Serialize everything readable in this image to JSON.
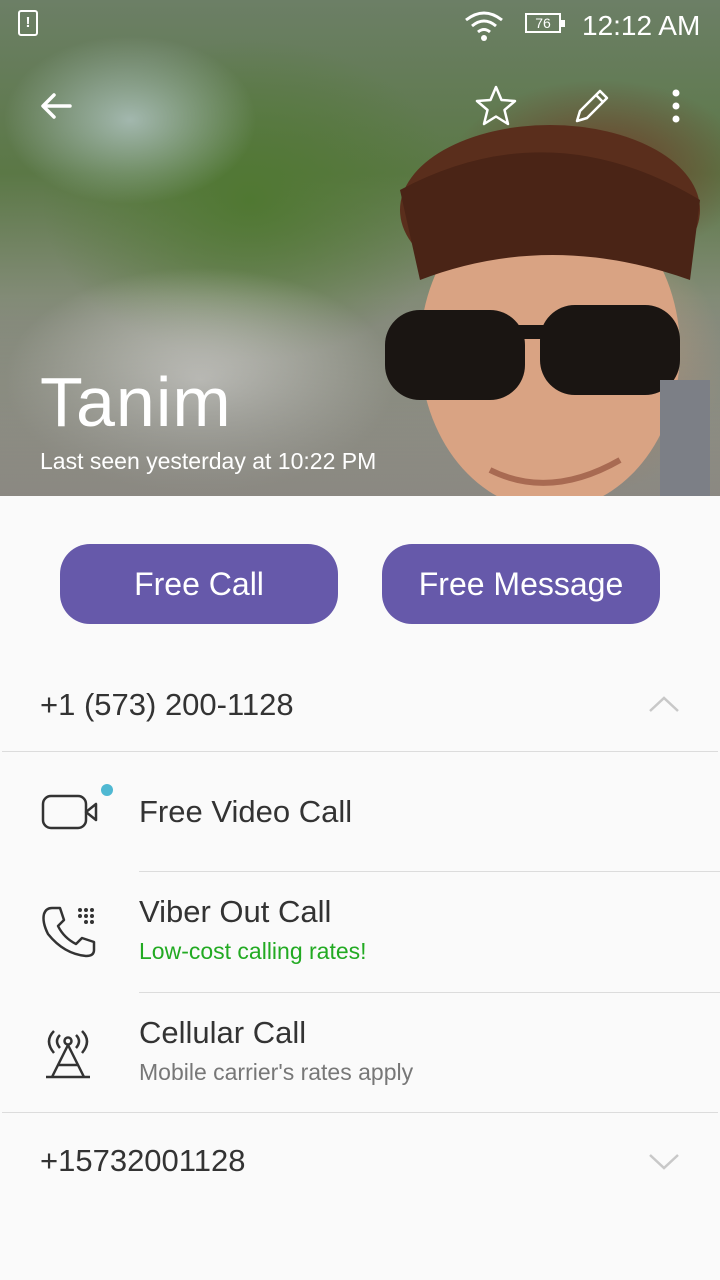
{
  "status_bar": {
    "notice_icon": "sim-alert-icon",
    "notice_glyph": "!",
    "battery_level": "76",
    "time": "12:12 AM"
  },
  "toolbar": {
    "back_icon": "back-arrow-icon",
    "favorite_icon": "star-icon",
    "edit_icon": "pencil-icon",
    "menu_icon": "more-vert-icon"
  },
  "contact": {
    "name": "Tanim",
    "last_seen": "Last seen yesterday at 10:22 PM"
  },
  "actions": {
    "free_call": "Free Call",
    "free_message": "Free Message",
    "accent_color": "#6659aa"
  },
  "numbers": [
    {
      "label": "+1 (573) 200-1128",
      "expanded": true,
      "options": [
        {
          "title": "Free Video Call",
          "subtitle": "",
          "icon": "video-camera-icon",
          "new_badge": true
        },
        {
          "title": "Viber Out Call",
          "subtitle": "Low-cost calling rates!",
          "subtitle_color": "#22aa22",
          "icon": "phone-dots-icon"
        },
        {
          "title": "Cellular Call",
          "subtitle": "Mobile carrier's rates apply",
          "subtitle_color": "#777777",
          "icon": "cell-tower-icon"
        }
      ]
    },
    {
      "label": "+15732001128",
      "expanded": false
    }
  ]
}
